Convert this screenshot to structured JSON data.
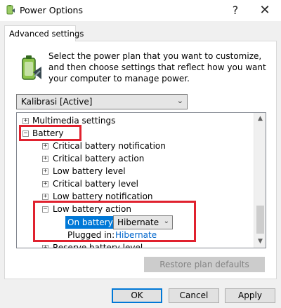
{
  "window": {
    "title": "Power Options",
    "help_glyph": "?",
    "close_glyph": "✕"
  },
  "tab": {
    "label": "Advanced settings"
  },
  "intro": {
    "text": "Select the power plan that you want to customize, and then choose settings that reflect how you want your computer to manage power."
  },
  "plan_select": {
    "value": "Kalibrasi [Active]",
    "arrow": "⌄"
  },
  "tree": {
    "items": [
      {
        "label": "Multimedia settings",
        "expander": "+"
      },
      {
        "label": "Battery",
        "expander": "−"
      },
      {
        "label": "Critical battery notification",
        "expander": "+"
      },
      {
        "label": "Critical battery action",
        "expander": "+"
      },
      {
        "label": "Low battery level",
        "expander": "+"
      },
      {
        "label": "Critical battery level",
        "expander": "+"
      },
      {
        "label": "Low battery notification",
        "expander": "+"
      },
      {
        "label": "Low battery action",
        "expander": "−"
      },
      {
        "label": "Reserve battery level",
        "expander": "+"
      }
    ],
    "on_battery_label": "On battery:",
    "on_battery_value": "Hibernate",
    "plugged_in_label": "Plugged in:",
    "plugged_in_value": "Hibernate"
  },
  "scroll": {
    "up": "▲",
    "down": "▼"
  },
  "buttons": {
    "restore": "Restore plan defaults",
    "ok": "OK",
    "cancel": "Cancel",
    "apply": "Apply"
  },
  "colors": {
    "highlight": "#e0212e",
    "link": "#0066cc",
    "selection": "#0078d7"
  }
}
